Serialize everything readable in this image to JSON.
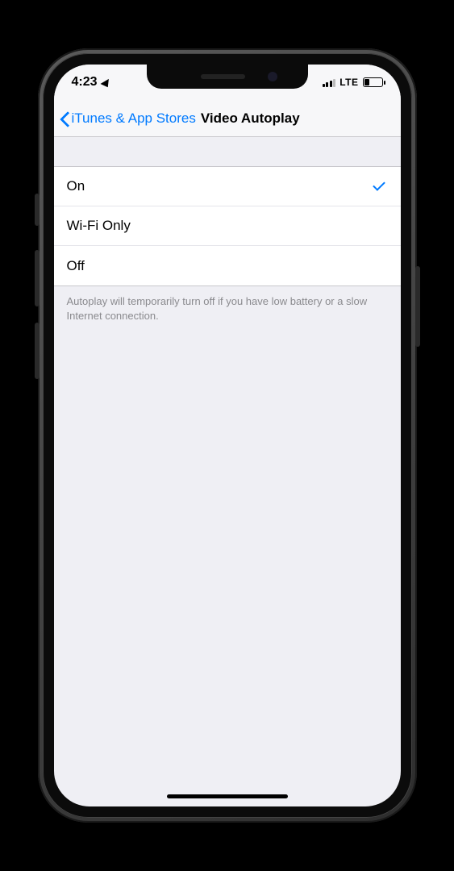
{
  "status": {
    "time": "4:23",
    "network_label": "LTE"
  },
  "nav": {
    "back_label": "iTunes & App Stores",
    "title": "Video Autoplay"
  },
  "options": [
    {
      "label": "On",
      "selected": true
    },
    {
      "label": "Wi-Fi Only",
      "selected": false
    },
    {
      "label": "Off",
      "selected": false
    }
  ],
  "footer_note": "Autoplay will temporarily turn off if you have low battery or a slow Internet connection."
}
